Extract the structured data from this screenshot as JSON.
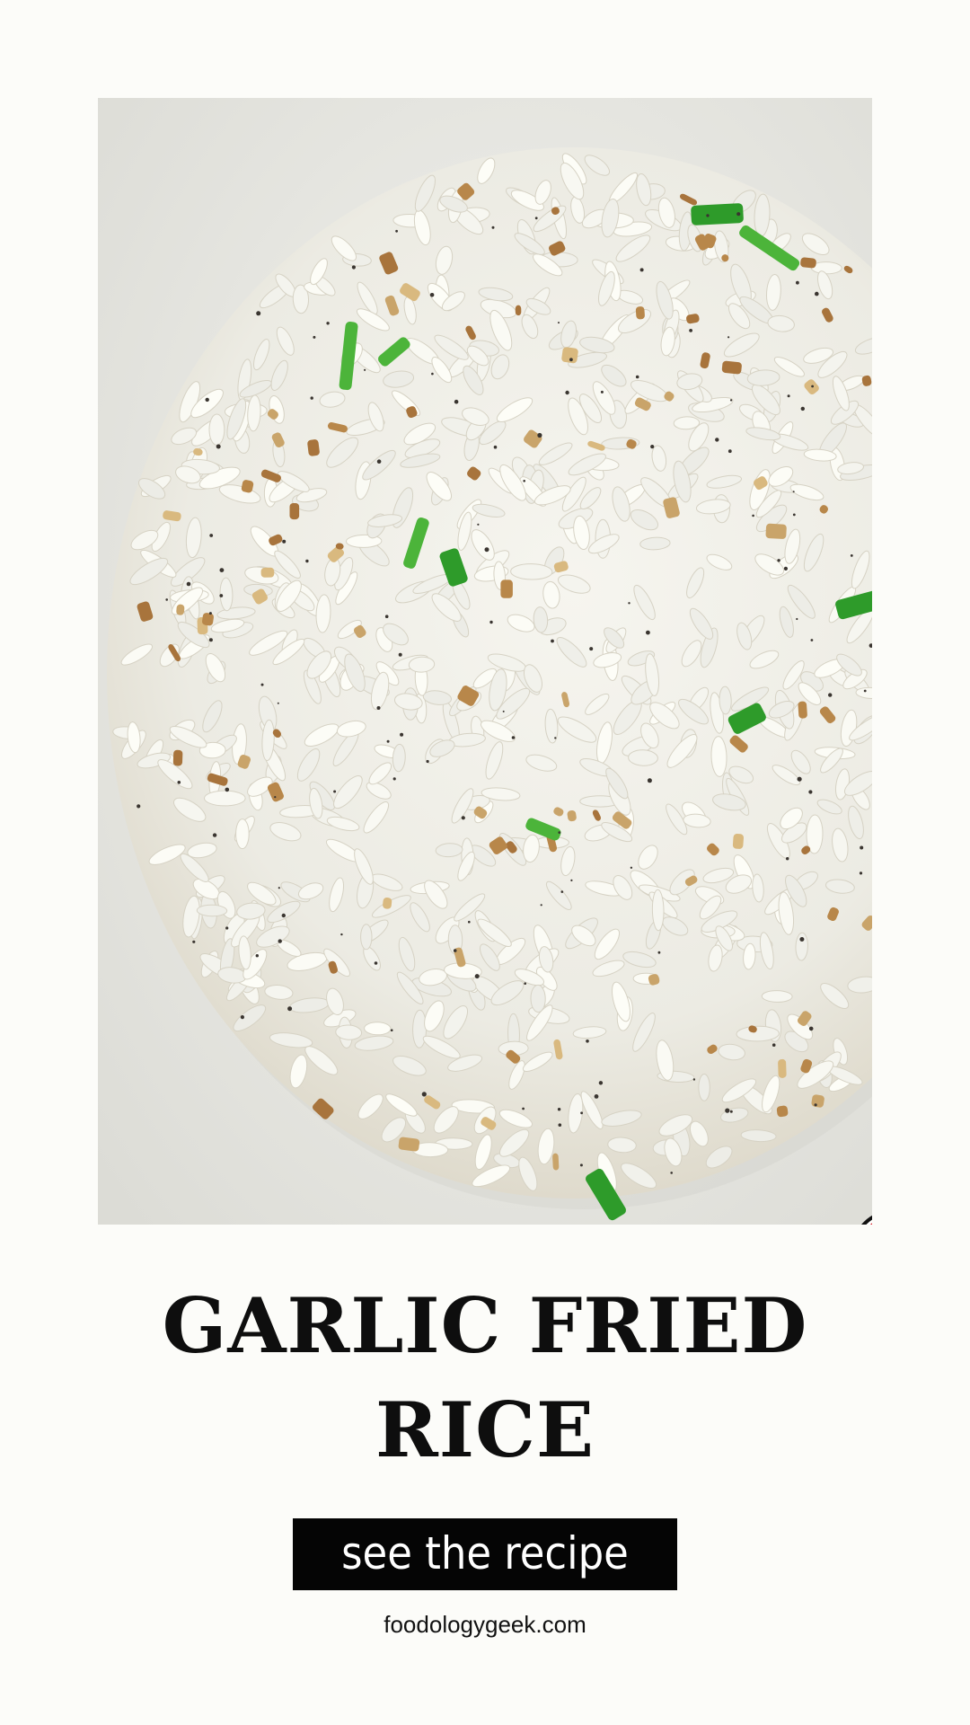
{
  "photo": {
    "subject": "garlic fried rice",
    "logo_icon": "fork-spoon-logo-icon",
    "logo_color": "#d8262c"
  },
  "title": {
    "line1": "GARLIC FRIED",
    "line2": "RICE"
  },
  "cta": {
    "label": "see the recipe"
  },
  "footer": {
    "website": "foodologygeek.com"
  },
  "colors": {
    "background": "#fcfcf9",
    "title": "#0e0e0e",
    "cta_background": "#050505",
    "cta_text": "#ffffff"
  }
}
